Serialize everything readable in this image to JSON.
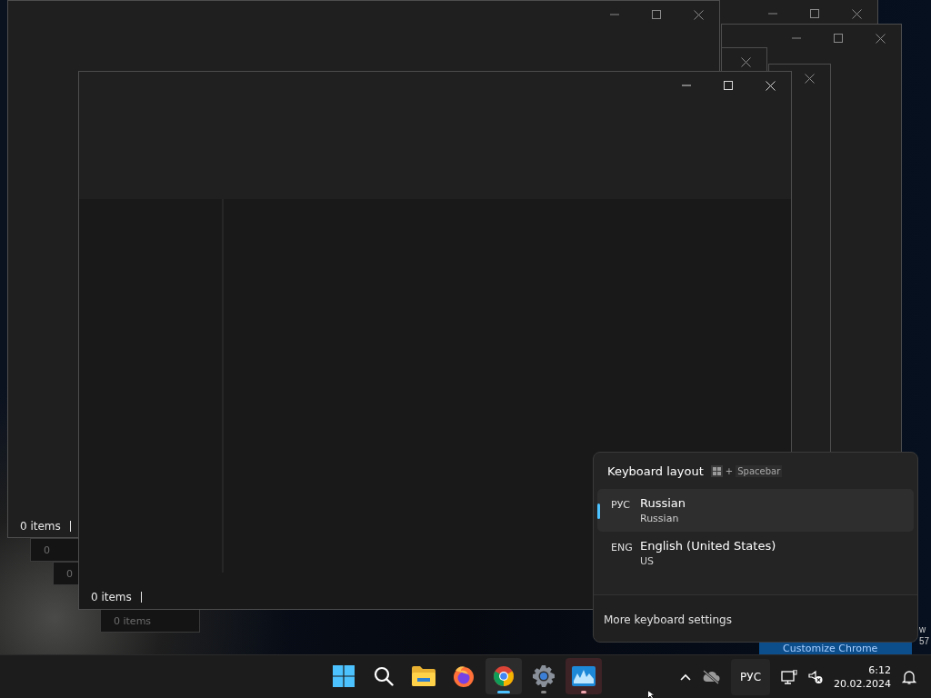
{
  "background_windows": [
    {
      "controls": [
        {
          "kind": "minimize"
        },
        {
          "kind": "maximize"
        },
        {
          "kind": "close"
        }
      ]
    },
    {
      "controls": [
        {
          "kind": "minimize"
        },
        {
          "kind": "maximize"
        },
        {
          "kind": "close"
        }
      ]
    },
    {
      "controls": [
        {
          "kind": "minimize"
        },
        {
          "kind": "maximize"
        },
        {
          "kind": "close"
        }
      ],
      "status": "0 items"
    },
    {
      "controls": [
        {
          "kind": "close"
        }
      ]
    },
    {
      "controls": [
        {
          "kind": "close"
        }
      ]
    }
  ],
  "ghost_windows": [
    {
      "status": "0"
    },
    {
      "status": "0"
    },
    {
      "status": "0 items"
    }
  ],
  "main_window": {
    "controls": [
      {
        "kind": "minimize"
      },
      {
        "kind": "maximize"
      },
      {
        "kind": "close"
      }
    ],
    "status": "0 items"
  },
  "desktop_edge_text": [
    "w",
    "57"
  ],
  "customize_chrome": {
    "label": "Customize Chrome"
  },
  "keyboard_flyout": {
    "title": "Keyboard layout",
    "shortcut": {
      "plus": "+",
      "key": "Spacebar"
    },
    "layouts": [
      {
        "code": "РУС",
        "name": "Russian",
        "detail": "Russian",
        "selected": true
      },
      {
        "code": "ENG",
        "name": "English (United States)",
        "detail": "US",
        "selected": false
      }
    ],
    "link": "More keyboard settings"
  },
  "taskbar": {
    "apps": [
      {
        "kind": "start",
        "open": false,
        "selected": false,
        "attention": false
      },
      {
        "kind": "search",
        "open": false,
        "selected": false,
        "attention": false
      },
      {
        "kind": "folder",
        "open": false,
        "selected": false,
        "attention": false
      },
      {
        "kind": "firefox",
        "open": false,
        "selected": false,
        "attention": false
      },
      {
        "kind": "chrome",
        "open": true,
        "selected": true,
        "attention": false
      },
      {
        "kind": "settings",
        "open": true,
        "selected": false,
        "attention": false
      },
      {
        "kind": "monitor",
        "open": true,
        "selected": false,
        "attention": true
      }
    ],
    "tray": {
      "language": "РУС",
      "time": "6:12",
      "date": "20.02.2024"
    }
  }
}
